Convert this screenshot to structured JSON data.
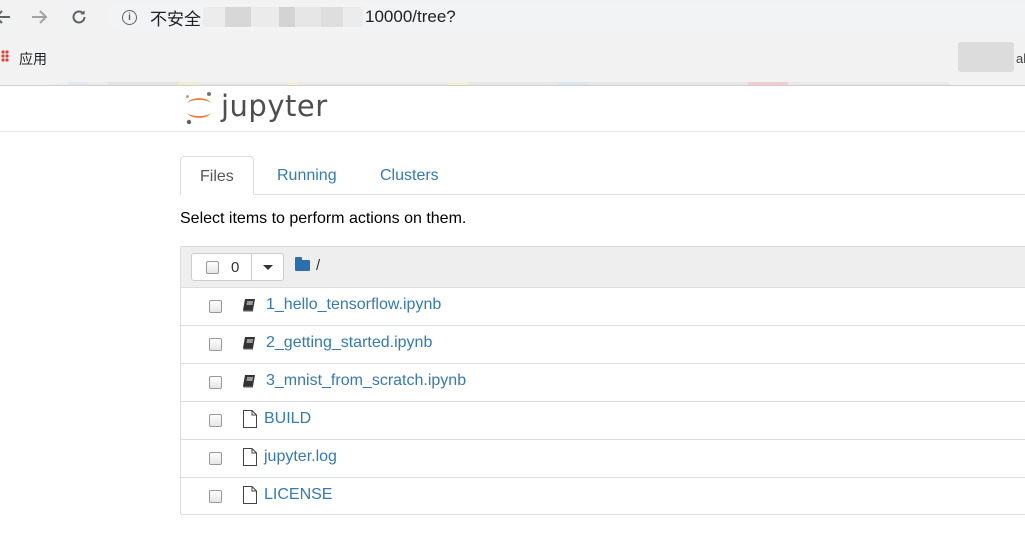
{
  "browser": {
    "security_label": "不安全",
    "url_tail": "10000/tree?",
    "apps_label": "应用",
    "bookmark_tail": "al"
  },
  "header": {
    "logo_text": "jupyter"
  },
  "tabs": [
    {
      "label": "Files",
      "active": true
    },
    {
      "label": "Running",
      "active": false
    },
    {
      "label": "Clusters",
      "active": false
    }
  ],
  "hint": "Select items to perform actions on them.",
  "toolbar": {
    "selected_count": "0",
    "breadcrumb": "/"
  },
  "files": [
    {
      "name": "1_hello_tensorflow.ipynb",
      "icon": "notebook-icon"
    },
    {
      "name": "2_getting_started.ipynb",
      "icon": "notebook-icon"
    },
    {
      "name": "3_mnist_from_scratch.ipynb",
      "icon": "notebook-icon"
    },
    {
      "name": "BUILD",
      "icon": "file-icon"
    },
    {
      "name": "jupyter.log",
      "icon": "file-icon"
    },
    {
      "name": "LICENSE",
      "icon": "file-icon"
    }
  ],
  "colors": {
    "link": "#337ab7",
    "logo_orange": "#f37726",
    "folder": "#2a6fb0"
  }
}
